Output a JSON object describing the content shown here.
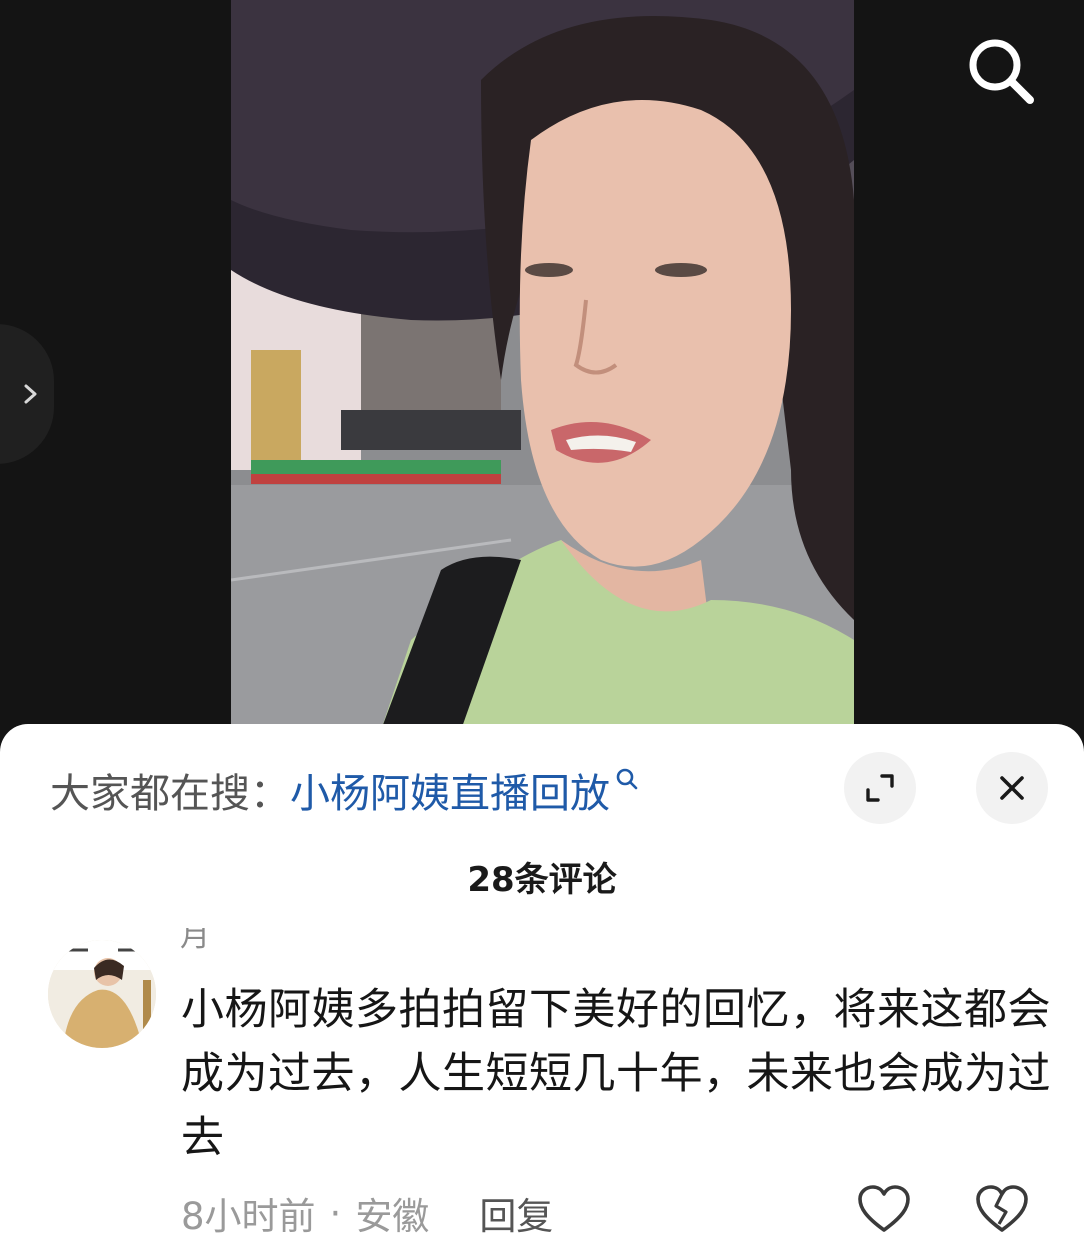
{
  "video": {
    "search_icon": "search-icon",
    "side_toggle_icon": "chevron-right-icon"
  },
  "sheet": {
    "suggest_label": "大家都在搜：",
    "suggest_query": "小杨阿姨直播回放",
    "comment_count": "28条评论",
    "expand_icon": "expand-icon",
    "close_icon": "close-icon"
  },
  "comment": {
    "username": "月",
    "text": "小杨阿姨多拍拍留下美好的回忆，将来这都会成为过去，人生短短几十年，未来也会成为过去",
    "time": "8小时前",
    "separator": "·",
    "location": "安徽",
    "reply_label": "回复",
    "like_icon": "heart-icon",
    "dislike_icon": "broken-heart-icon"
  },
  "colors": {
    "link": "#1f5aa8",
    "background": "#151515",
    "sheet": "#ffffff"
  }
}
